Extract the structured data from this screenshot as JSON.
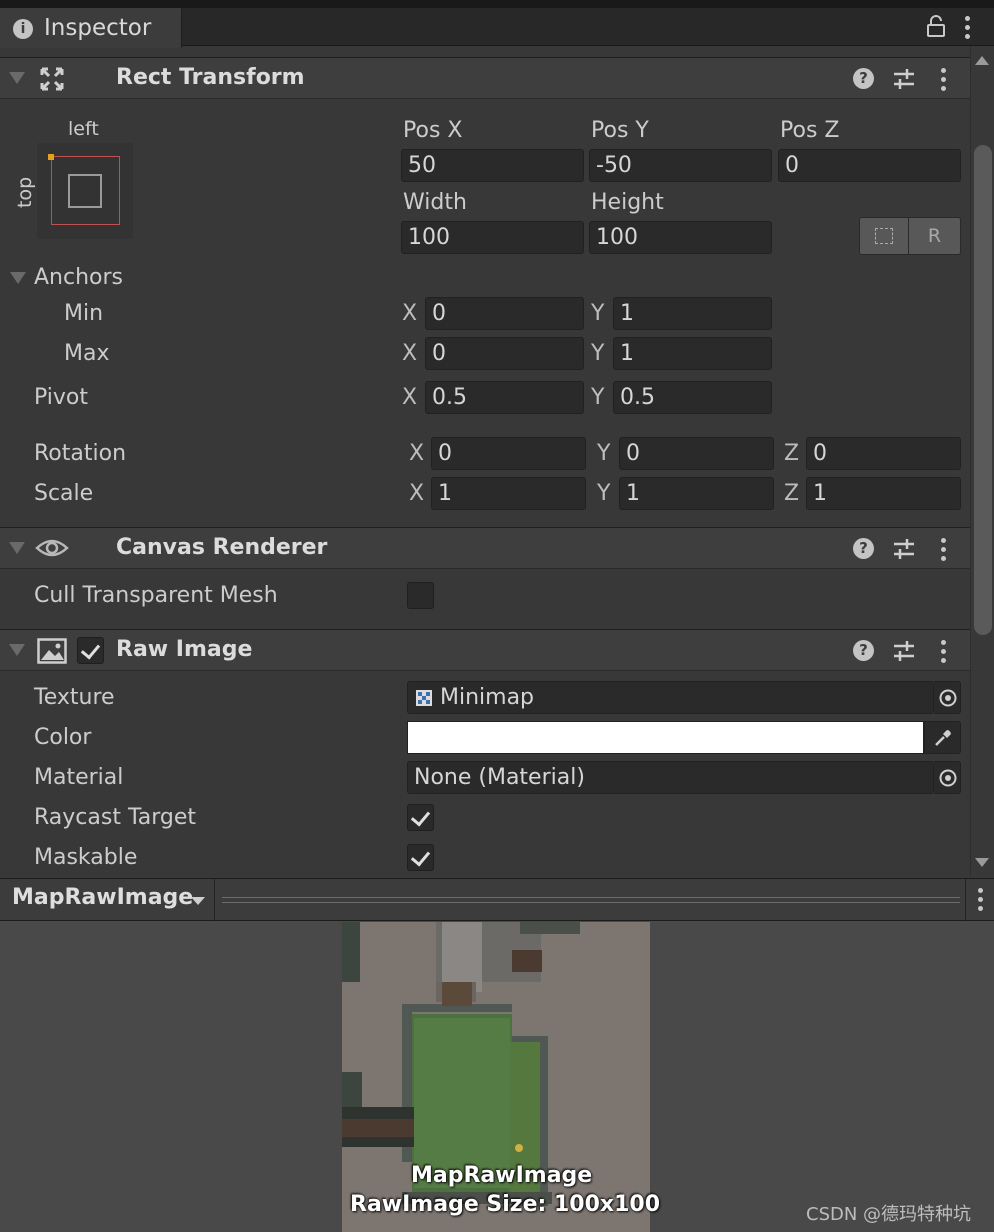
{
  "window": {
    "tab_label": "Inspector"
  },
  "rect_transform": {
    "title": "Rect Transform",
    "anchor_preset": {
      "horizontal": "left",
      "vertical": "top"
    },
    "pos_x_label": "Pos X",
    "pos_y_label": "Pos Y",
    "pos_z_label": "Pos Z",
    "pos_x": "50",
    "pos_y": "-50",
    "pos_z": "0",
    "width_label": "Width",
    "height_label": "Height",
    "width": "100",
    "height": "100",
    "raw_edit_label": "R",
    "anchors_label": "Anchors",
    "min_label": "Min",
    "max_label": "Max",
    "min_x": "0",
    "min_y": "1",
    "max_x": "0",
    "max_y": "1",
    "pivot_label": "Pivot",
    "pivot_x": "0.5",
    "pivot_y": "0.5",
    "rotation_label": "Rotation",
    "rot_x": "0",
    "rot_y": "0",
    "rot_z": "0",
    "scale_label": "Scale",
    "scale_x": "1",
    "scale_y": "1",
    "scale_z": "1",
    "axis_x": "X",
    "axis_y": "Y",
    "axis_z": "Z"
  },
  "canvas_renderer": {
    "title": "Canvas Renderer",
    "cull_label": "Cull Transparent Mesh",
    "cull_checked": false
  },
  "raw_image": {
    "title": "Raw Image",
    "enabled": true,
    "texture_label": "Texture",
    "texture_value": "Minimap",
    "color_label": "Color",
    "color_value": "#ffffff",
    "material_label": "Material",
    "material_value": "None (Material)",
    "raycast_label": "Raycast Target",
    "raycast_checked": true,
    "maskable_label": "Maskable",
    "maskable_checked": true
  },
  "preview": {
    "title": "MapRawImage",
    "caption_name": "MapRawImage",
    "caption_size": "RawImage Size: 100x100"
  },
  "watermark": "CSDN @德玛特种坑",
  "colors": {
    "panel": "#383838",
    "header": "#3e3e3e",
    "field": "#2a2a2a",
    "preview_bg": "#494949"
  }
}
